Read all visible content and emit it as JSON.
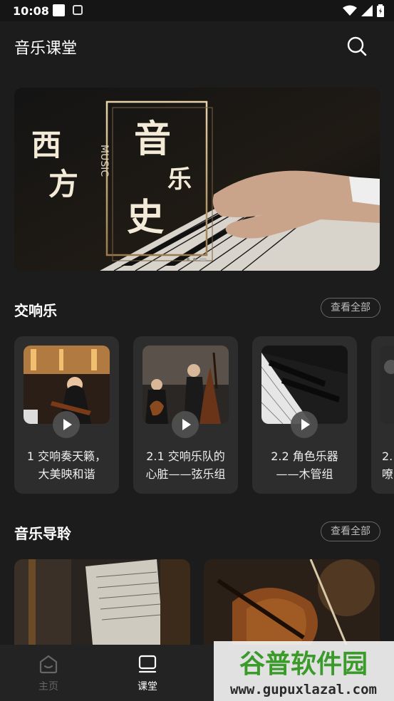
{
  "status_bar": {
    "time": "10:08"
  },
  "header": {
    "title": "音乐课堂"
  },
  "banner": {
    "poster_text": [
      "西",
      "方",
      "音",
      "乐",
      "史"
    ],
    "poster_subtext": "MUSIC"
  },
  "symphony_section": {
    "title": "交响乐",
    "view_all": "查看全部",
    "cards": [
      {
        "line1": "1 交响奏天籁，",
        "line2": "大美映和谐"
      },
      {
        "line1": "2.1 交响乐队的",
        "line2": "心脏——弦乐组"
      },
      {
        "line1": "2.2 角色乐器",
        "line2": "——木管组"
      },
      {
        "line1": "2.",
        "line2": "嘹"
      }
    ]
  },
  "guide_section": {
    "title": "音乐导聆",
    "view_all": "查看全部"
  },
  "bottom_nav": {
    "items": [
      {
        "label": "主页"
      },
      {
        "label": "课堂"
      }
    ]
  },
  "watermark": {
    "title": "谷普软件园",
    "url": "www.gupuxlazal.com"
  }
}
